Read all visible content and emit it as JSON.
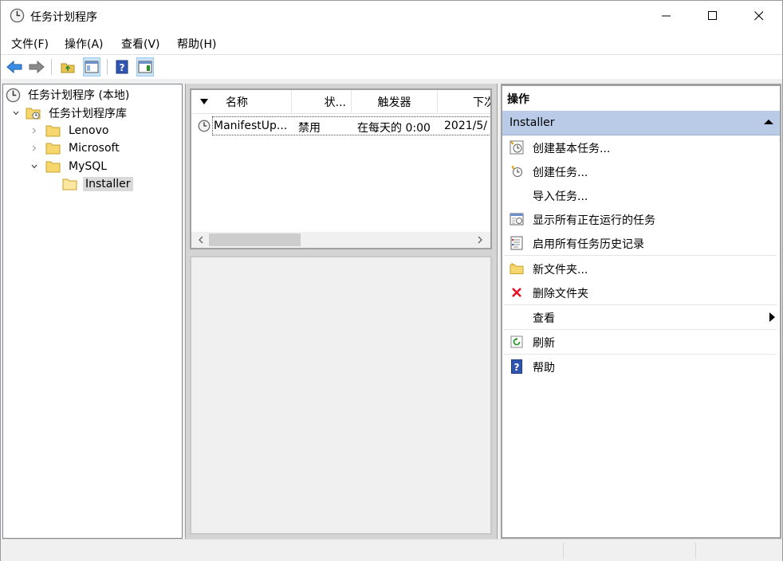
{
  "window": {
    "title": "任务计划程序"
  },
  "menu": [
    "文件(F)",
    "操作(A)",
    "查看(V)",
    "帮助(H)"
  ],
  "toolbar": {
    "buttons": [
      "back-arrow-icon",
      "forward-arrow-icon",
      "folder-up-icon",
      "show-hide-tree-icon",
      "help-icon",
      "show-hide-action-pane-icon"
    ]
  },
  "tree": {
    "root": "任务计划程序 (本地)",
    "library": "任务计划程序库",
    "folders": [
      "Lenovo",
      "Microsoft",
      "MySQL"
    ],
    "subfolder": "Installer"
  },
  "tasklist": {
    "columns": [
      "名称",
      "状...",
      "触发器",
      "下次"
    ],
    "rows": [
      {
        "name": "ManifestUp...",
        "status": "禁用",
        "trigger": "在每天的 0:00",
        "next": "2021/5/"
      }
    ]
  },
  "actions": {
    "title": "操作",
    "section": "Installer",
    "items": [
      {
        "label": "创建基本任务...",
        "icon": "create-basic-task-icon"
      },
      {
        "label": "创建任务...",
        "icon": "create-task-icon"
      },
      {
        "label": "导入任务...",
        "icon": ""
      },
      {
        "label": "显示所有正在运行的任务",
        "icon": "running-tasks-icon"
      },
      {
        "label": "启用所有任务历史记录",
        "icon": "task-history-icon"
      },
      {
        "label": "新文件夹...",
        "icon": "new-folder-icon"
      },
      {
        "label": "删除文件夹",
        "icon": "delete-icon"
      },
      {
        "label": "查看",
        "icon": ""
      },
      {
        "label": "刷新",
        "icon": "refresh-icon"
      },
      {
        "label": "帮助",
        "icon": "help-icon"
      }
    ]
  },
  "colors": {
    "accent_header": "#b9cbe6",
    "delete_red": "#e81123",
    "folder_yellow": "#f5d76e"
  }
}
